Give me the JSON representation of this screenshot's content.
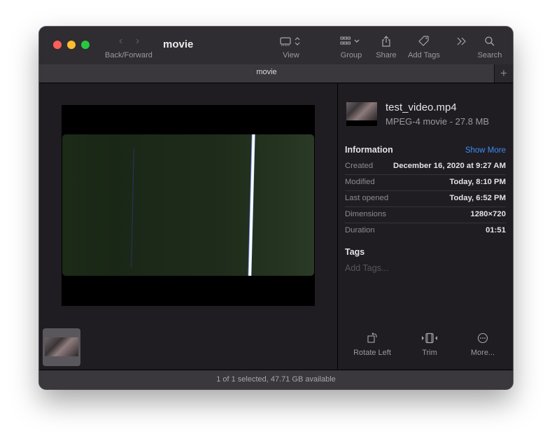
{
  "window": {
    "title": "movie",
    "tab_title": "movie",
    "add_tab_symbol": "+"
  },
  "toolbar": {
    "back_forward_label": "Back/Forward",
    "back_symbol": "‹",
    "forward_symbol": "›",
    "items": [
      {
        "id": "view",
        "label": "View",
        "icon": "view-icon"
      },
      {
        "id": "group",
        "label": "Group",
        "icon": "group-icon"
      },
      {
        "id": "share",
        "label": "Share",
        "icon": "share-icon"
      },
      {
        "id": "add-tags",
        "label": "Add Tags",
        "icon": "tag-icon"
      },
      {
        "id": "overflow",
        "label": "",
        "icon": "chevrons-right-icon"
      },
      {
        "id": "search",
        "label": "Search",
        "icon": "search-icon"
      }
    ]
  },
  "inspector": {
    "file_name": "test_video.mp4",
    "file_kind": "MPEG-4 movie - 27.8 MB",
    "information_title": "Information",
    "show_more_label": "Show More",
    "info_rows": [
      {
        "key": "Created",
        "value": "December 16, 2020 at 9:27 AM"
      },
      {
        "key": "Modified",
        "value": "Today, 8:10 PM"
      },
      {
        "key": "Last opened",
        "value": "Today, 6:52 PM"
      },
      {
        "key": "Dimensions",
        "value": "1280×720"
      },
      {
        "key": "Duration",
        "value": "01:51"
      }
    ],
    "tags_title": "Tags",
    "tags_placeholder": "Add Tags...",
    "actions": [
      {
        "label": "Rotate Left",
        "icon": "rotate-left-icon"
      },
      {
        "label": "Trim",
        "icon": "trim-icon"
      },
      {
        "label": "More...",
        "icon": "more-icon"
      }
    ]
  },
  "status_bar": {
    "text": "1 of 1 selected, 47.71 GB available"
  },
  "colors": {
    "accent": "#3d8ff5",
    "close": "#fe5f57",
    "minimize": "#febc2e",
    "zoom": "#28c840"
  }
}
